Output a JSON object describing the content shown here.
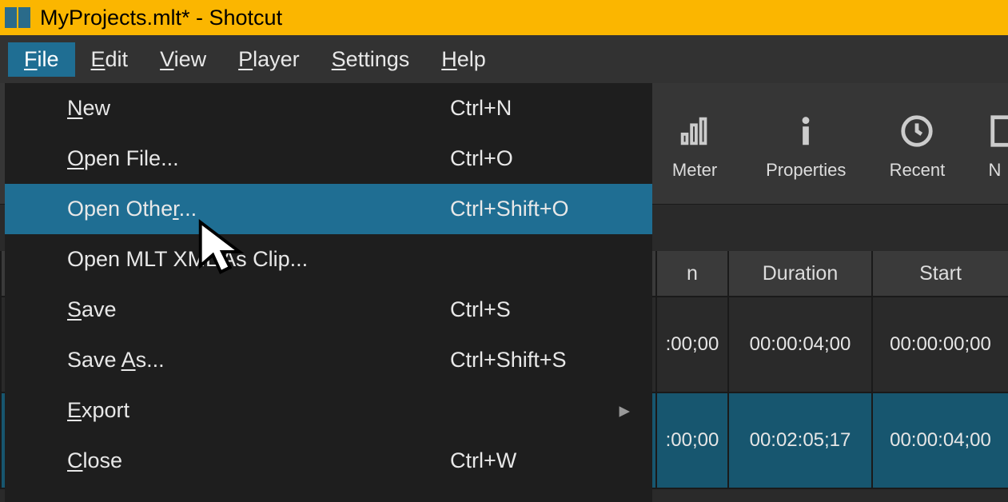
{
  "titlebar": {
    "title": "MyProjects.mlt* - Shotcut"
  },
  "menubar": {
    "items": [
      {
        "pre": "",
        "ul": "F",
        "post": "ile"
      },
      {
        "pre": "",
        "ul": "E",
        "post": "dit"
      },
      {
        "pre": "",
        "ul": "V",
        "post": "iew"
      },
      {
        "pre": "",
        "ul": "P",
        "post": "layer"
      },
      {
        "pre": "",
        "ul": "S",
        "post": "ettings"
      },
      {
        "pre": "",
        "ul": "H",
        "post": "elp"
      }
    ]
  },
  "file_menu": {
    "items": [
      {
        "label_pre": "",
        "label_ul": "N",
        "label_post": "ew",
        "shortcut": "Ctrl+N",
        "submenu": false
      },
      {
        "label_pre": "",
        "label_ul": "O",
        "label_post": "pen File...",
        "shortcut": "Ctrl+O",
        "submenu": false
      },
      {
        "label_pre": "Open Othe",
        "label_ul": "r",
        "label_post": "...",
        "shortcut": "Ctrl+Shift+O",
        "submenu": false,
        "hover": true
      },
      {
        "label_pre": "Open MLT XML As Clip...",
        "label_ul": "",
        "label_post": "",
        "shortcut": "",
        "submenu": false
      },
      {
        "label_pre": "",
        "label_ul": "S",
        "label_post": "ave",
        "shortcut": "Ctrl+S",
        "submenu": false
      },
      {
        "label_pre": "Save ",
        "label_ul": "A",
        "label_post": "s...",
        "shortcut": "Ctrl+Shift+S",
        "submenu": false
      },
      {
        "label_pre": "",
        "label_ul": "E",
        "label_post": "xport",
        "shortcut": "",
        "submenu": true
      },
      {
        "label_pre": "",
        "label_ul": "C",
        "label_post": "lose",
        "shortcut": "Ctrl+W",
        "submenu": false
      }
    ]
  },
  "toolbar": {
    "buttons": [
      {
        "label": "Meter",
        "icon": "meter-icon"
      },
      {
        "label": "Properties",
        "icon": "info-icon"
      },
      {
        "label": "Recent",
        "icon": "clock-icon"
      },
      {
        "label": "N",
        "icon": "partial-icon"
      }
    ]
  },
  "table": {
    "headers": {
      "c1": "n",
      "c2": "Duration",
      "c3": "Start"
    },
    "rows": [
      {
        "c1": ":00;00",
        "c2": "00:00:04;00",
        "c3": "00:00:00;00",
        "selected": false
      },
      {
        "c1": ":00;00",
        "c2": "00:02:05;17",
        "c3": "00:00:04;00",
        "selected": true
      }
    ]
  }
}
